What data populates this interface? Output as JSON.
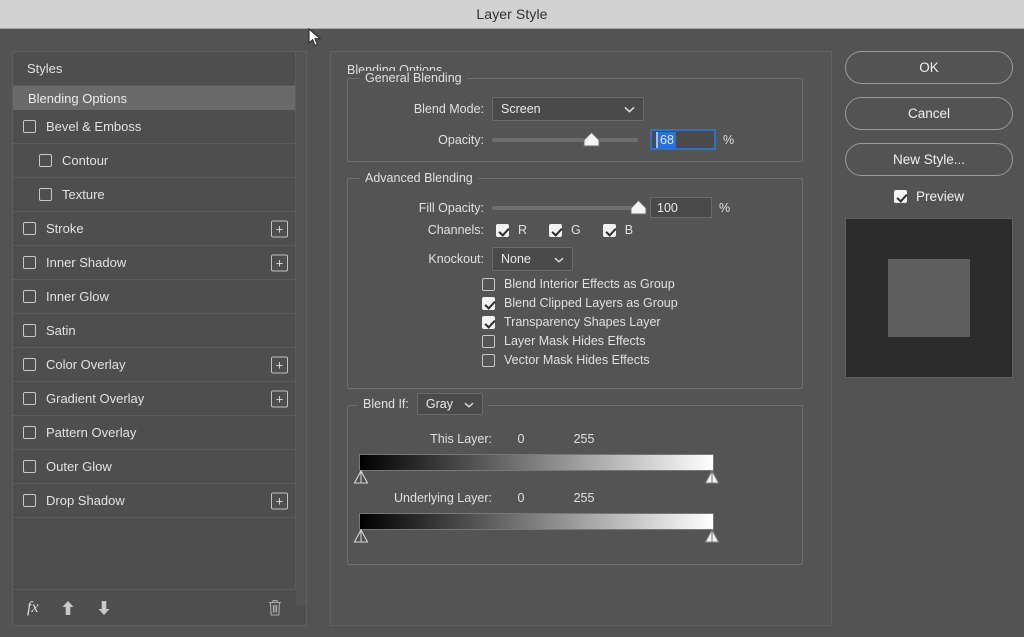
{
  "window": {
    "title": "Layer Style"
  },
  "sidebar": {
    "items": [
      {
        "label": "Styles",
        "checkbox": false,
        "checked": false,
        "selected": false,
        "indent": false,
        "plus": false
      },
      {
        "label": "Blending Options",
        "checkbox": false,
        "checked": false,
        "selected": true,
        "indent": false,
        "plus": false
      },
      {
        "label": "Bevel & Emboss",
        "checkbox": true,
        "checked": false,
        "selected": false,
        "indent": false,
        "plus": false
      },
      {
        "label": "Contour",
        "checkbox": true,
        "checked": false,
        "selected": false,
        "indent": true,
        "plus": false
      },
      {
        "label": "Texture",
        "checkbox": true,
        "checked": false,
        "selected": false,
        "indent": true,
        "plus": false
      },
      {
        "label": "Stroke",
        "checkbox": true,
        "checked": false,
        "selected": false,
        "indent": false,
        "plus": true
      },
      {
        "label": "Inner Shadow",
        "checkbox": true,
        "checked": false,
        "selected": false,
        "indent": false,
        "plus": true
      },
      {
        "label": "Inner Glow",
        "checkbox": true,
        "checked": false,
        "selected": false,
        "indent": false,
        "plus": false
      },
      {
        "label": "Satin",
        "checkbox": true,
        "checked": false,
        "selected": false,
        "indent": false,
        "plus": false
      },
      {
        "label": "Color Overlay",
        "checkbox": true,
        "checked": false,
        "selected": false,
        "indent": false,
        "plus": true
      },
      {
        "label": "Gradient Overlay",
        "checkbox": true,
        "checked": false,
        "selected": false,
        "indent": false,
        "plus": true
      },
      {
        "label": "Pattern Overlay",
        "checkbox": true,
        "checked": false,
        "selected": false,
        "indent": false,
        "plus": false
      },
      {
        "label": "Outer Glow",
        "checkbox": true,
        "checked": false,
        "selected": false,
        "indent": false,
        "plus": false
      },
      {
        "label": "Drop Shadow",
        "checkbox": true,
        "checked": false,
        "selected": false,
        "indent": false,
        "plus": true
      }
    ],
    "footer": {
      "fx_label": "fx",
      "icons": [
        "fx-icon",
        "move-up-icon",
        "move-down-icon",
        "trash-icon"
      ]
    }
  },
  "main": {
    "section_title": "Blending Options",
    "general": {
      "title": "General Blending",
      "blend_mode_label": "Blend Mode:",
      "blend_mode_value": "Screen",
      "opacity_label": "Opacity:",
      "opacity_value": "68",
      "opacity_percent": "%",
      "opacity_slider_pct": 68
    },
    "advanced": {
      "title": "Advanced Blending",
      "fill_opacity_label": "Fill Opacity:",
      "fill_opacity_value": "100",
      "fill_opacity_percent": "%",
      "fill_opacity_slider_pct": 100,
      "channels_label": "Channels:",
      "channels": [
        {
          "label": "R",
          "checked": true
        },
        {
          "label": "G",
          "checked": true
        },
        {
          "label": "B",
          "checked": true
        }
      ],
      "knockout_label": "Knockout:",
      "knockout_value": "None",
      "options": [
        {
          "label": "Blend Interior Effects as Group",
          "checked": false
        },
        {
          "label": "Blend Clipped Layers as Group",
          "checked": true
        },
        {
          "label": "Transparency Shapes Layer",
          "checked": true
        },
        {
          "label": "Layer Mask Hides Effects",
          "checked": false
        },
        {
          "label": "Vector Mask Hides Effects",
          "checked": false
        }
      ]
    },
    "blend_if": {
      "title": "Blend If:",
      "channel_value": "Gray",
      "this_layer": {
        "label": "This Layer:",
        "min": "0",
        "max": "255"
      },
      "underlying_layer": {
        "label": "Underlying Layer:",
        "min": "0",
        "max": "255"
      }
    }
  },
  "actions": {
    "ok": "OK",
    "cancel": "Cancel",
    "new_style": "New Style...",
    "preview_label": "Preview",
    "preview_checked": true
  },
  "colors": {
    "dialog_bg": "#535353",
    "panel_bg": "#545454",
    "sidebar_bg": "#4e4e4e",
    "sidebar_selected": "#6a6a6a",
    "titlebar_bg": "#d2d2d2",
    "accent_blue": "#2f6fd0",
    "text": "#e0e0e0",
    "thumbnail_bg": "#2c2c2c",
    "thumbnail_square": "#5e5e5e"
  }
}
